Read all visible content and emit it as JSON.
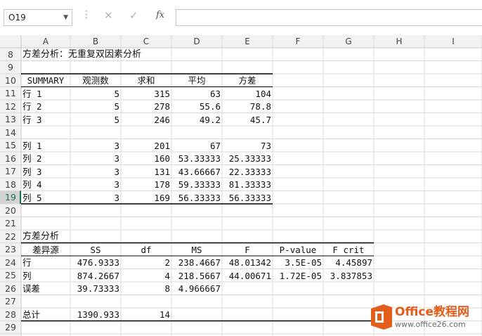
{
  "formula_bar": {
    "name_box": "O19",
    "cancel_icon": "✕",
    "enter_icon": "✓",
    "fx_label": "fx",
    "formula": ""
  },
  "grid": {
    "columns": [
      "A",
      "B",
      "C",
      "D",
      "E",
      "F",
      "G",
      "H",
      "I"
    ],
    "rows": [
      "8",
      "9",
      "10",
      "11",
      "12",
      "13",
      "14",
      "15",
      "16",
      "17",
      "18",
      "19",
      "20",
      "21",
      "22",
      "23",
      "24",
      "25",
      "26",
      "27",
      "28",
      "29"
    ],
    "selected_row": "19"
  },
  "cells": {
    "r8": [
      "方差分析：无重复双因素分析",
      "",
      "",
      "",
      "",
      "",
      ""
    ],
    "r9": [
      "",
      "",
      "",
      "",
      "",
      "",
      ""
    ],
    "r10": [
      "SUMMARY",
      "观测数",
      "求和",
      "平均",
      "方差",
      "",
      ""
    ],
    "r11": [
      "行 1",
      "5",
      "315",
      "63",
      "104",
      "",
      ""
    ],
    "r12": [
      "行 2",
      "5",
      "278",
      "55.6",
      "78.8",
      "",
      ""
    ],
    "r13": [
      "行 3",
      "5",
      "246",
      "49.2",
      "45.7",
      "",
      ""
    ],
    "r14": [
      "",
      "",
      "",
      "",
      "",
      "",
      ""
    ],
    "r15": [
      "列 1",
      "3",
      "201",
      "67",
      "73",
      "",
      ""
    ],
    "r16": [
      "列 2",
      "3",
      "160",
      "53.33333",
      "25.33333",
      "",
      ""
    ],
    "r17": [
      "列 3",
      "3",
      "131",
      "43.66667",
      "22.33333",
      "",
      ""
    ],
    "r18": [
      "列 4",
      "3",
      "178",
      "59.33333",
      "81.33333",
      "",
      ""
    ],
    "r19": [
      "列 5",
      "3",
      "169",
      "56.33333",
      "56.33333",
      "",
      ""
    ],
    "r20": [
      "",
      "",
      "",
      "",
      "",
      "",
      ""
    ],
    "r21": [
      "",
      "",
      "",
      "",
      "",
      "",
      ""
    ],
    "r22": [
      "方差分析",
      "",
      "",
      "",
      "",
      "",
      ""
    ],
    "r23": [
      "差异源",
      "SS",
      "df",
      "MS",
      "F",
      "P-value",
      "F crit"
    ],
    "r24": [
      "行",
      "476.9333",
      "2",
      "238.4667",
      "48.01342",
      "3.5E-05",
      "4.45897"
    ],
    "r25": [
      "列",
      "874.2667",
      "4",
      "218.5667",
      "44.00671",
      "1.72E-05",
      "3.837853"
    ],
    "r26": [
      "误差",
      "39.73333",
      "8",
      "4.966667",
      "",
      "",
      ""
    ],
    "r27": [
      "",
      "",
      "",
      "",
      "",
      "",
      ""
    ],
    "r28": [
      "总计",
      "1390.933",
      "14",
      "",
      "",
      "",
      ""
    ],
    "r29": [
      "",
      "",
      "",
      "",
      "",
      "",
      ""
    ]
  },
  "watermark": {
    "brand": "Office教程网",
    "url": "www.office26.com",
    "logo_color": "#e35d1b"
  }
}
